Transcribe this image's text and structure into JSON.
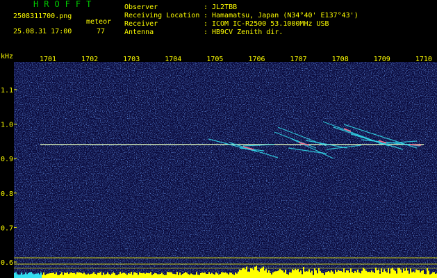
{
  "header": {
    "brand": "HROFFT",
    "filename": "2508311700.png",
    "datetime": "25.08.31 17:00",
    "meteor_label": "meteor",
    "meteor_count": "77",
    "info": [
      {
        "label": "Observer",
        "value": "JL2TBB"
      },
      {
        "label": "Receiving Location",
        "value": "Hamamatsu, Japan (N34°40' E137°43')"
      },
      {
        "label": "Receiver",
        "value": "ICOM IC-R2500 53.1000MHz USB"
      },
      {
        "label": "Antenna",
        "value": "HB9CV Zenith dir."
      }
    ]
  },
  "spectrogram": {
    "unit_label": "kHz",
    "time_ticks": [
      "1701",
      "1702",
      "1703",
      "1704",
      "1705",
      "1706",
      "1707",
      "1708",
      "1709",
      "1710"
    ],
    "freq_ticks": [
      "1.1",
      "1.0",
      "0.9",
      "0.8",
      "0.7",
      "0.6"
    ],
    "colors": {
      "text": "#ffff00",
      "background": "#0a0a3c",
      "carrier": "#c8e6a0",
      "cyan": "#33ddee",
      "brand": "#00cc00"
    }
  }
}
